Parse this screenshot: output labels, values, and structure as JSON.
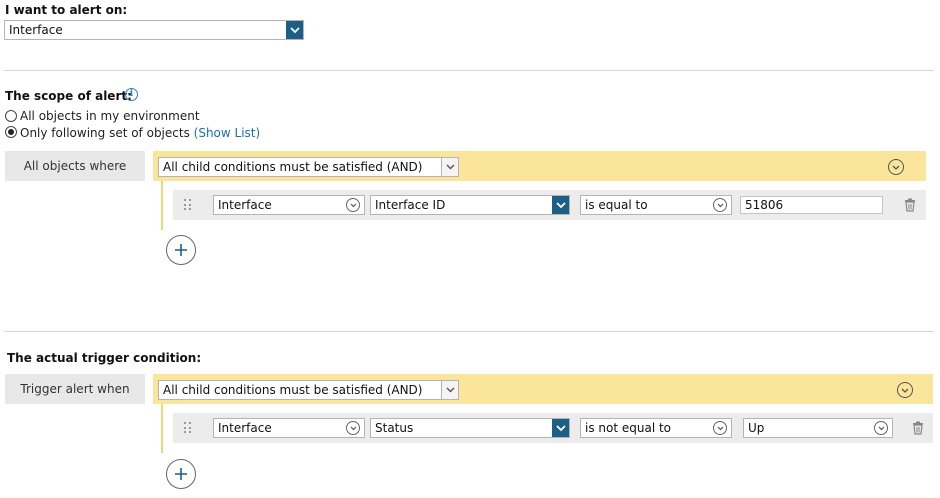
{
  "alert_on": {
    "heading": "I want to alert on:",
    "selected": "Interface"
  },
  "scope": {
    "heading": "The scope of alert:",
    "info_icon": "info-icon",
    "options": [
      {
        "label": "All objects in my environment",
        "selected": false
      },
      {
        "label": "Only following set of objects",
        "selected": true
      }
    ],
    "show_list_label": "(Show List)",
    "group_label": "All objects where",
    "logic_selected": "All child conditions must be satisfied (AND)",
    "condition": {
      "object": "Interface",
      "property": "Interface ID",
      "operator": "is equal to",
      "value": "51806"
    }
  },
  "trigger": {
    "heading": "The actual trigger condition:",
    "group_label": "Trigger alert when",
    "logic_selected": "All child conditions must be satisfied (AND)",
    "condition": {
      "object": "Interface",
      "property": "Status",
      "operator": "is not equal to",
      "value": "Up"
    }
  },
  "icons": {
    "drag": "drag-handle-icon",
    "delete": "trash-icon",
    "add": "plus-circle-icon",
    "collapse": "chevron-down-circle-icon"
  },
  "colors": {
    "accent_dark": "#1b5f86",
    "group_bar": "#fbe59a",
    "link": "#1a6fb0"
  }
}
